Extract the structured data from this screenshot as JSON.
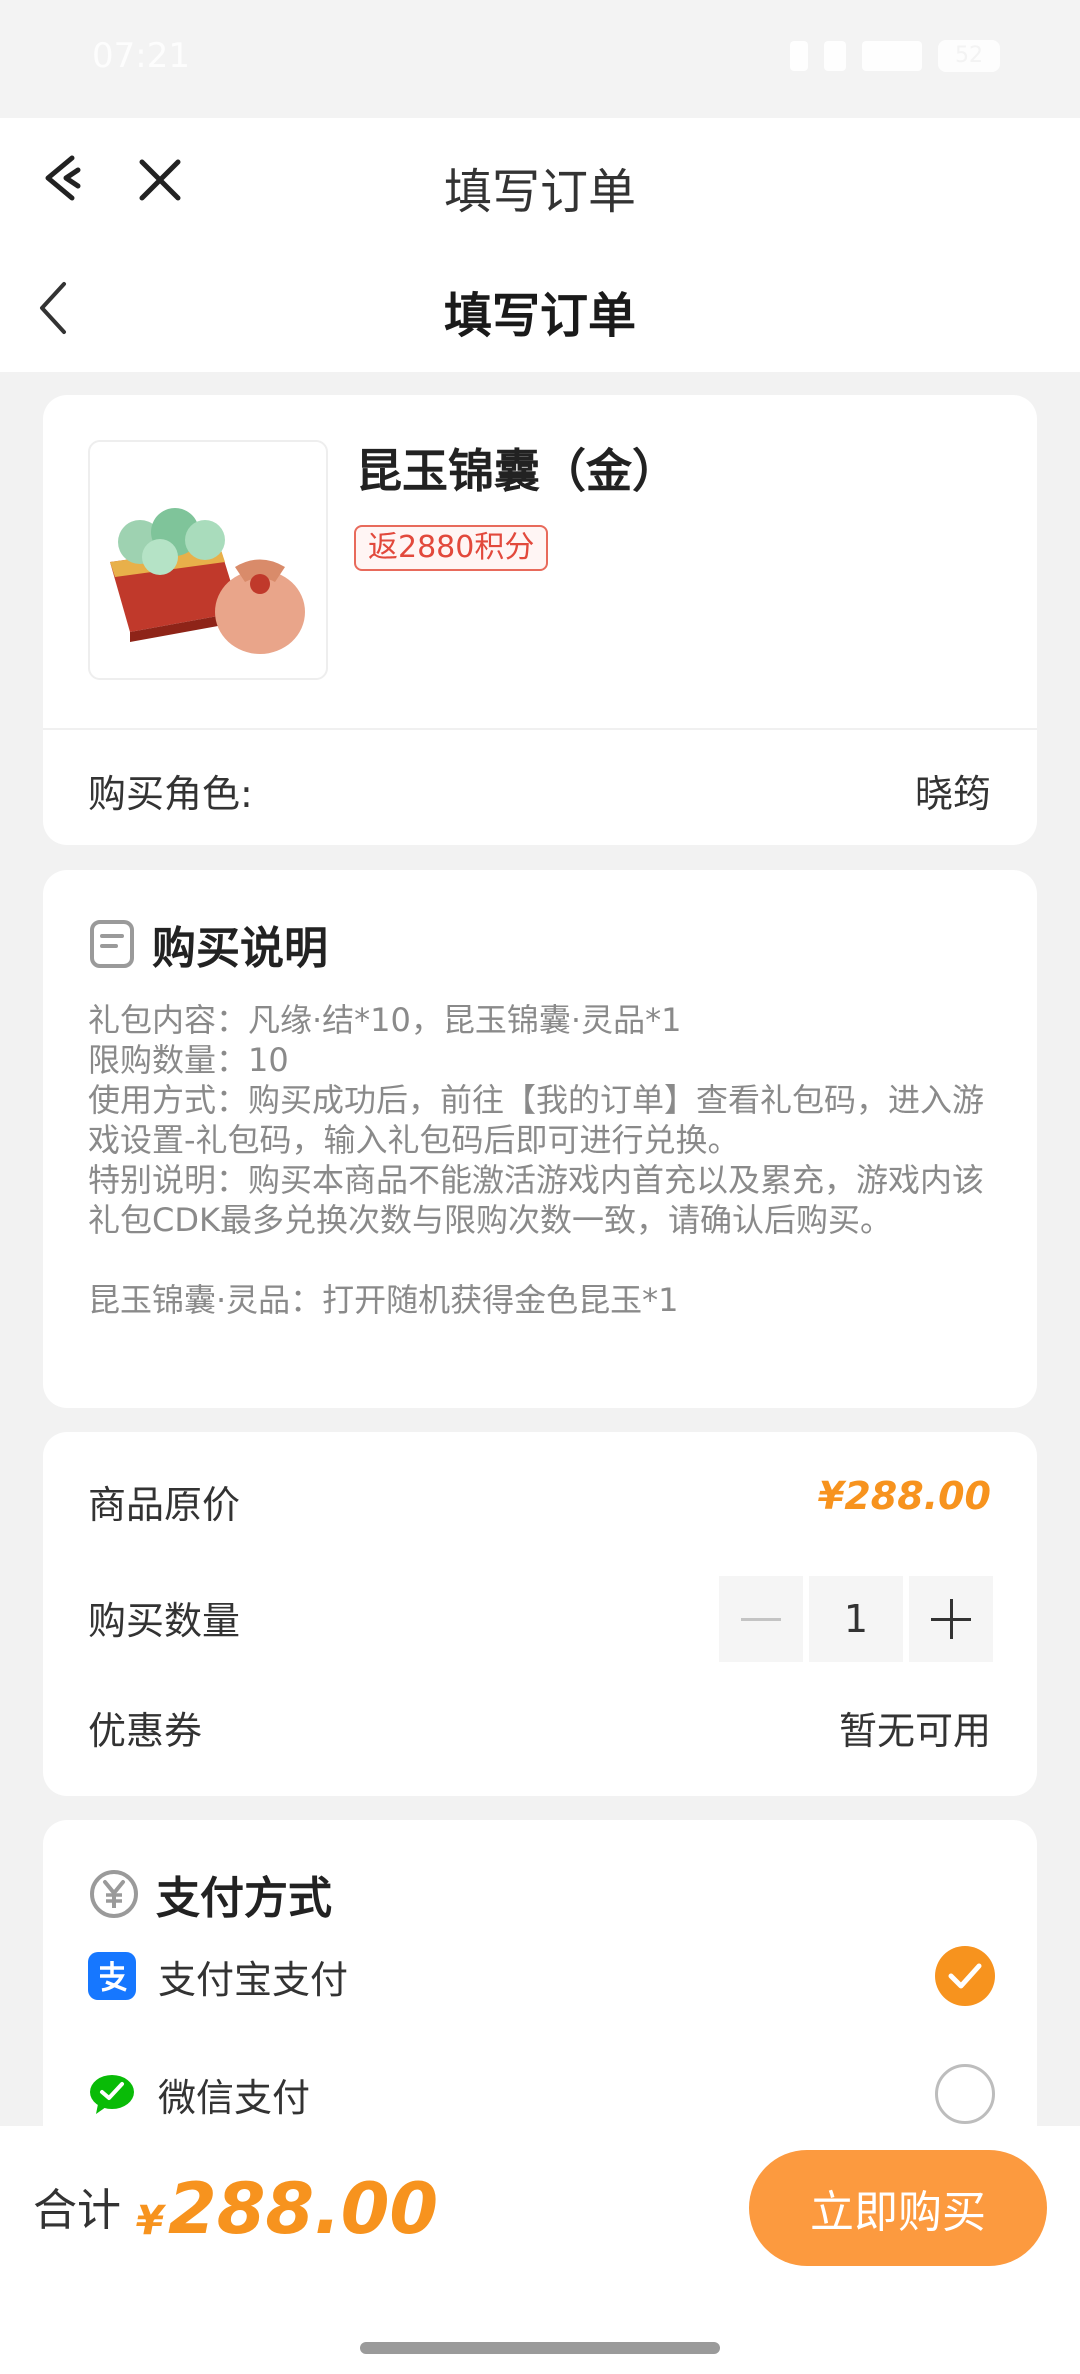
{
  "status_bar": {
    "time": "07:21",
    "battery": "52"
  },
  "host_nav": {
    "title": "填写订单"
  },
  "page_nav": {
    "title": "填写订单"
  },
  "product": {
    "name": "昆玉锦囊（金）",
    "tag": "返2880积分",
    "role_label": "购买角色:",
    "role_value": "晓筠"
  },
  "description": {
    "title": "购买说明",
    "body": "礼包内容：凡缘·结*10，昆玉锦囊·灵品*1\n限购数量：10\n使用方式：购买成功后，前往【我的订单】查看礼包码，进入游戏设置-礼包码，输入礼包码后即可进行兑换。\n特别说明：购买本商品不能激活游戏内首充以及累充，游戏内该礼包CDK最多兑换次数与限购次数一致，请确认后购买。\n\n昆玉锦囊·灵品：打开随机获得金色昆玉*1"
  },
  "pricing": {
    "original_label": "商品原价",
    "original_price": "¥288.00",
    "quantity_label": "购买数量",
    "quantity": "1",
    "coupon_label": "优惠券",
    "coupon_value": "暂无可用"
  },
  "payment": {
    "title": "支付方式",
    "methods": [
      {
        "label": "支付宝支付",
        "selected": true,
        "icon": "alipay-icon",
        "color": "#1677ff"
      },
      {
        "label": "微信支付",
        "selected": false,
        "icon": "wechat-pay-icon",
        "color": "#09bb07"
      }
    ]
  },
  "footer": {
    "total_label": "合计",
    "currency": "¥",
    "total": "288.00",
    "buy_label": "立即购买"
  },
  "colors": {
    "accent": "#f7931e",
    "button": "#fc9a3f",
    "tag": "#e2493c"
  }
}
